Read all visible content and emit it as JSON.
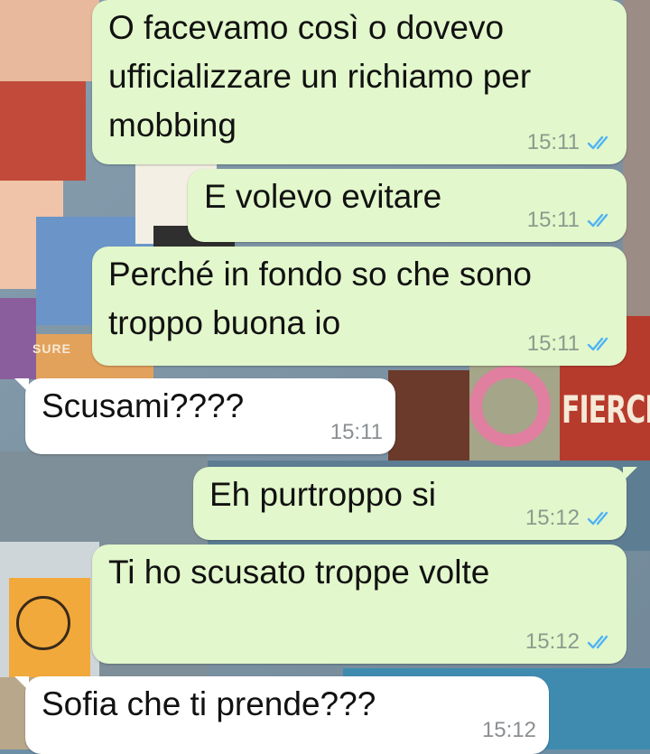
{
  "messages": [
    {
      "direction": "outgoing",
      "text": "O facevamo così o dovevo\nufficializzare un richiamo per\nmobbing",
      "time": "15:11",
      "status": "read"
    },
    {
      "direction": "outgoing",
      "text": "E volevo evitare",
      "time": "15:11",
      "status": "read"
    },
    {
      "direction": "outgoing",
      "text": "Perché in fondo so che sono\ntroppo buona io",
      "time": "15:11",
      "status": "read"
    },
    {
      "direction": "incoming",
      "text": "Scusami????",
      "time": "15:11"
    },
    {
      "direction": "outgoing",
      "text": "Eh purtroppo si",
      "time": "15:12",
      "status": "read"
    },
    {
      "direction": "outgoing",
      "text": "Ti ho scusato troppe volte",
      "time": "15:12",
      "status": "read"
    },
    {
      "direction": "incoming",
      "text": "Sofia che ti prende???",
      "time": "15:12"
    }
  ],
  "wallpaper": {
    "sticker_text_1": "SURE",
    "sticker_text_2": "FIERCE"
  },
  "colors": {
    "outgoing_bubble": "#e2f7cb",
    "incoming_bubble": "#ffffff",
    "read_tick": "#4fb3f6",
    "timestamp": "#8c9a8e"
  },
  "icons": {
    "read_receipt": "double-check-icon"
  }
}
